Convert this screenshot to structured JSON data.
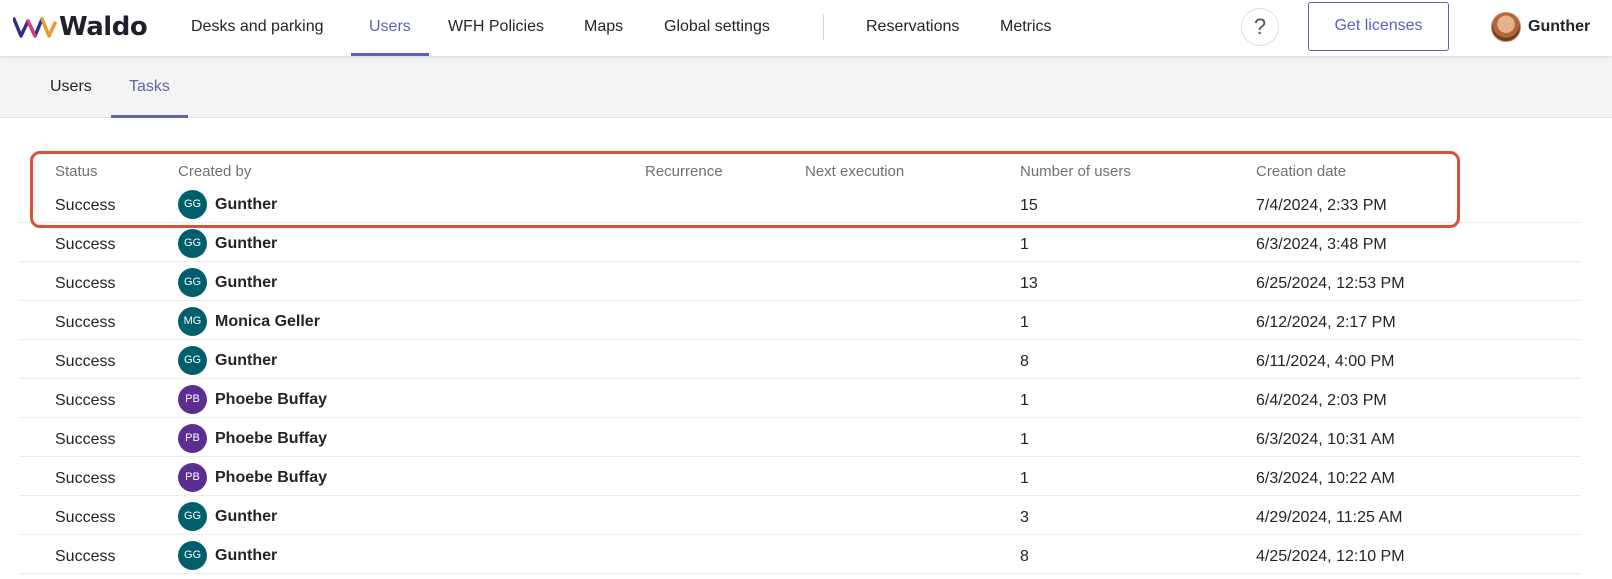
{
  "app": {
    "brand": "Waldo",
    "logo_icon": "waldo-wave-logo"
  },
  "topnav": {
    "items": [
      {
        "label": "Desks and parking",
        "active": false
      },
      {
        "label": "Users",
        "active": true
      },
      {
        "label": "WFH Policies",
        "active": false
      },
      {
        "label": "Maps",
        "active": false
      },
      {
        "label": "Global settings",
        "active": false
      },
      {
        "label": "Reservations",
        "active": false
      },
      {
        "label": "Metrics",
        "active": false
      }
    ],
    "help_label": "?",
    "license_button": "Get licenses",
    "user_name": "Gunther"
  },
  "subtabs": [
    {
      "label": "Users",
      "active": false
    },
    {
      "label": "Tasks",
      "active": true
    }
  ],
  "table": {
    "headers": {
      "status": "Status",
      "created_by": "Created by",
      "recurrence": "Recurrence",
      "next_execution": "Next execution",
      "number_of_users": "Number of users",
      "creation_date": "Creation date"
    },
    "rows": [
      {
        "status": "Success",
        "initials": "GG",
        "creator": "Gunther",
        "recurrence": "",
        "next_execution": "",
        "users": "15",
        "date": "7/4/2024, 2:33 PM",
        "color": "#005f6b"
      },
      {
        "status": "Success",
        "initials": "GG",
        "creator": "Gunther",
        "recurrence": "",
        "next_execution": "",
        "users": "1",
        "date": "6/3/2024, 3:48 PM",
        "color": "#005f6b"
      },
      {
        "status": "Success",
        "initials": "GG",
        "creator": "Gunther",
        "recurrence": "",
        "next_execution": "",
        "users": "13",
        "date": "6/25/2024, 12:53 PM",
        "color": "#005f6b"
      },
      {
        "status": "Success",
        "initials": "MG",
        "creator": "Monica Geller",
        "recurrence": "",
        "next_execution": "",
        "users": "1",
        "date": "6/12/2024, 2:17 PM",
        "color": "#005f6b"
      },
      {
        "status": "Success",
        "initials": "GG",
        "creator": "Gunther",
        "recurrence": "",
        "next_execution": "",
        "users": "8",
        "date": "6/11/2024, 4:00 PM",
        "color": "#005f6b"
      },
      {
        "status": "Success",
        "initials": "PB",
        "creator": "Phoebe Buffay",
        "recurrence": "",
        "next_execution": "",
        "users": "1",
        "date": "6/4/2024, 2:03 PM",
        "color": "#5c2e91"
      },
      {
        "status": "Success",
        "initials": "PB",
        "creator": "Phoebe Buffay",
        "recurrence": "",
        "next_execution": "",
        "users": "1",
        "date": "6/3/2024, 10:31 AM",
        "color": "#5c2e91"
      },
      {
        "status": "Success",
        "initials": "PB",
        "creator": "Phoebe Buffay",
        "recurrence": "",
        "next_execution": "",
        "users": "1",
        "date": "6/3/2024, 10:22 AM",
        "color": "#5c2e91"
      },
      {
        "status": "Success",
        "initials": "GG",
        "creator": "Gunther",
        "recurrence": "",
        "next_execution": "",
        "users": "3",
        "date": "4/29/2024, 11:25 AM",
        "color": "#005f6b"
      },
      {
        "status": "Success",
        "initials": "GG",
        "creator": "Gunther",
        "recurrence": "",
        "next_execution": "",
        "users": "8",
        "date": "4/25/2024, 12:10 PM",
        "color": "#005f6b"
      }
    ]
  },
  "colors": {
    "accent": "#5b5fc7",
    "highlight": "#d9503a"
  }
}
